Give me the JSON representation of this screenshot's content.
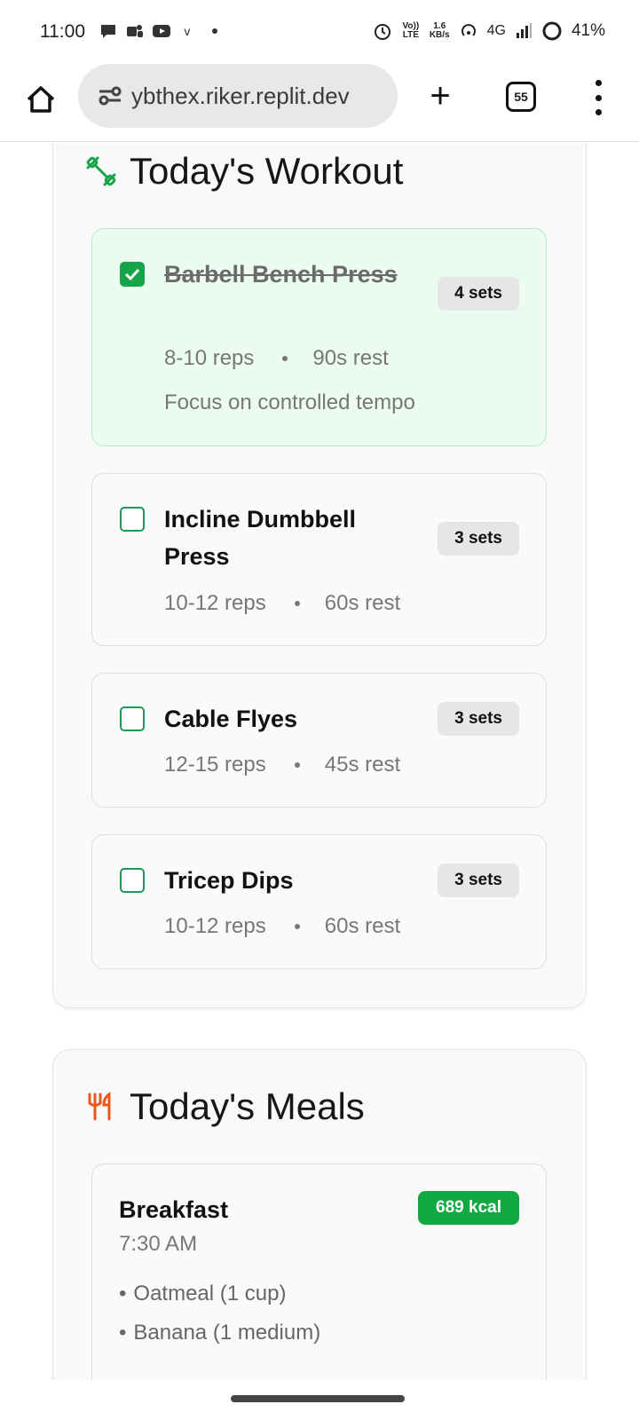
{
  "status": {
    "time": "11:00",
    "volte": "Vo)) LTE",
    "speed_value": "1.6",
    "speed_unit": "KB/s",
    "network": "4G",
    "battery": "41%"
  },
  "browser": {
    "url": "ybthex.riker.replit.dev",
    "tab_count": "55"
  },
  "workout": {
    "title": "Today's Workout",
    "icon": "dumbbell-icon",
    "exercises": [
      {
        "name": "Barbell Bench Press",
        "sets": "4 sets",
        "reps": "8-10 reps",
        "rest": "90s rest",
        "note": "Focus on controlled tempo",
        "completed": true
      },
      {
        "name": "Incline Dumbbell Press",
        "sets": "3 sets",
        "reps": "10-12 reps",
        "rest": "60s rest",
        "completed": false
      },
      {
        "name": "Cable Flyes",
        "sets": "3 sets",
        "reps": "12-15 reps",
        "rest": "45s rest",
        "completed": false
      },
      {
        "name": "Tricep Dips",
        "sets": "3 sets",
        "reps": "10-12 reps",
        "rest": "60s rest",
        "completed": false
      }
    ]
  },
  "meals": {
    "title": "Today's Meals",
    "icon": "utensils-icon",
    "items": [
      {
        "name": "Breakfast",
        "time": "7:30 AM",
        "kcal": "689 kcal",
        "foods": [
          "Oatmeal (1 cup)",
          "Banana (1 medium)"
        ]
      }
    ]
  },
  "colors": {
    "accent_green": "#16a34a",
    "completed_bg": "#ebfbef",
    "meals_icon": "#e8581c"
  }
}
